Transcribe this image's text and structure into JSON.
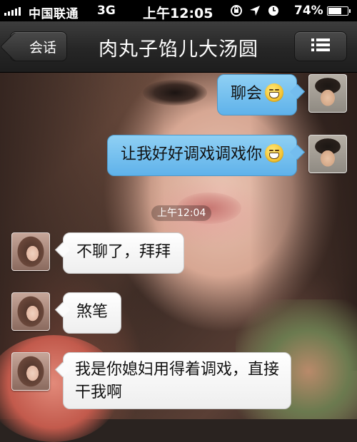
{
  "status_bar": {
    "carrier": "中国联通",
    "network": "3G",
    "time": "上午12:05",
    "battery_percent": "74%",
    "battery_level": 0.74,
    "icons": [
      "rotation-lock-icon",
      "location-arrow-icon",
      "alarm-clock-icon",
      "battery-icon"
    ]
  },
  "nav": {
    "back_label": "会话",
    "title": "肉丸子馅儿大汤圆",
    "menu_icon": "list-icon"
  },
  "messages": [
    {
      "from": "me",
      "text": "聊会",
      "emoji": "grinning-face-icon"
    },
    {
      "from": "me",
      "text": "让我好好调戏调戏你",
      "emoji": "grinning-face-icon"
    },
    {
      "from": "them",
      "text": "不聊了，拜拜"
    },
    {
      "from": "them",
      "text": "煞笔"
    },
    {
      "from": "them",
      "text": "我是你媳妇用得着调戏，直接干我啊"
    }
  ],
  "timestamp": "上午12:04",
  "colors": {
    "outgoing_bubble": "#74bdee",
    "incoming_bubble": "#ffffff",
    "navbar": "#262626"
  }
}
